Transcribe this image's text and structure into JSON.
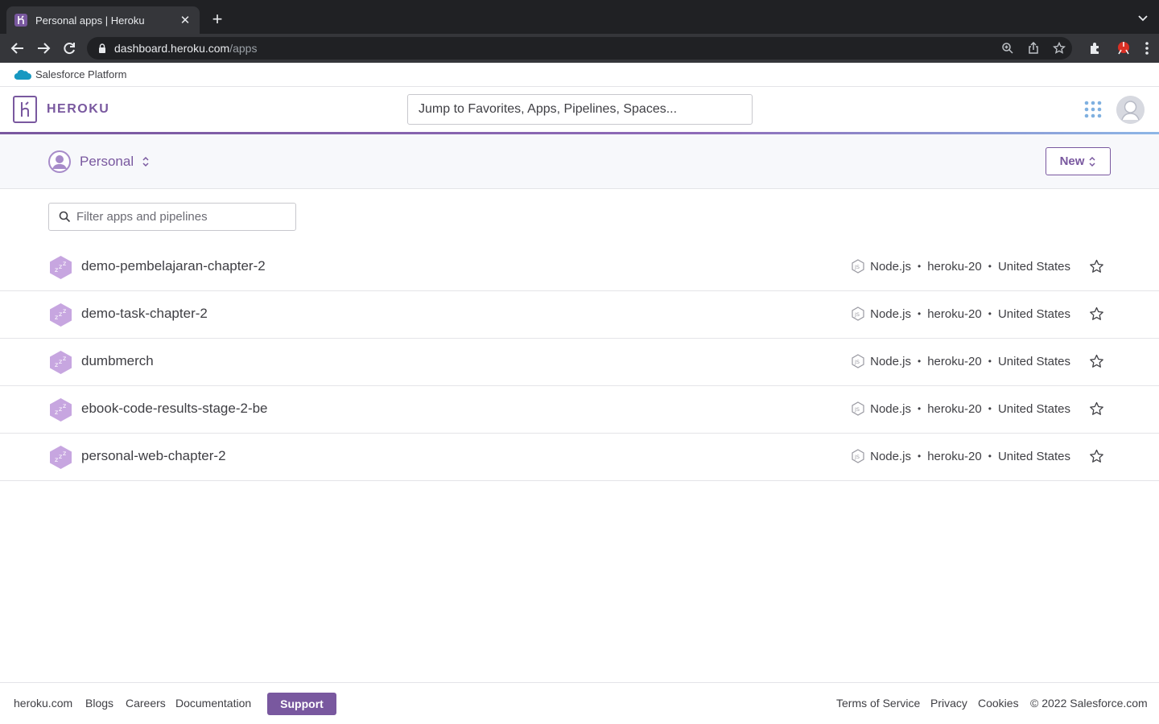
{
  "browser": {
    "tab_title": "Personal apps | Heroku",
    "url_host": "dashboard.heroku.com",
    "url_path": "/apps"
  },
  "salesforce_bar": {
    "label": "Salesforce Platform"
  },
  "header": {
    "wordmark": "HEROKU",
    "search_placeholder": "Jump to Favorites, Apps, Pipelines, Spaces..."
  },
  "context": {
    "label": "Personal",
    "new_button": "New"
  },
  "filter": {
    "placeholder": "Filter apps and pipelines"
  },
  "apps": [
    {
      "name": "demo-pembelajaran-chapter-2",
      "language": "Node.js",
      "stack": "heroku-20",
      "region": "United States"
    },
    {
      "name": "demo-task-chapter-2",
      "language": "Node.js",
      "stack": "heroku-20",
      "region": "United States"
    },
    {
      "name": "dumbmerch",
      "language": "Node.js",
      "stack": "heroku-20",
      "region": "United States"
    },
    {
      "name": "ebook-code-results-stage-2-be",
      "language": "Node.js",
      "stack": "heroku-20",
      "region": "United States"
    },
    {
      "name": "personal-web-chapter-2",
      "language": "Node.js",
      "stack": "heroku-20",
      "region": "United States"
    }
  ],
  "footer": {
    "links_left": [
      "heroku.com",
      "Blogs",
      "Careers",
      "Documentation"
    ],
    "support": "Support",
    "links_right": [
      "Terms of Service",
      "Privacy",
      "Cookies",
      "© 2022 Salesforce.com"
    ]
  },
  "colors": {
    "brand": "#79589f",
    "app_icon": "#c7a6e0",
    "sf_blue": "#1798c1"
  },
  "icons": {
    "app_state": "sleeping-dyno-icon",
    "language": "nodejs-icon",
    "favorite": "star-outline-icon"
  }
}
